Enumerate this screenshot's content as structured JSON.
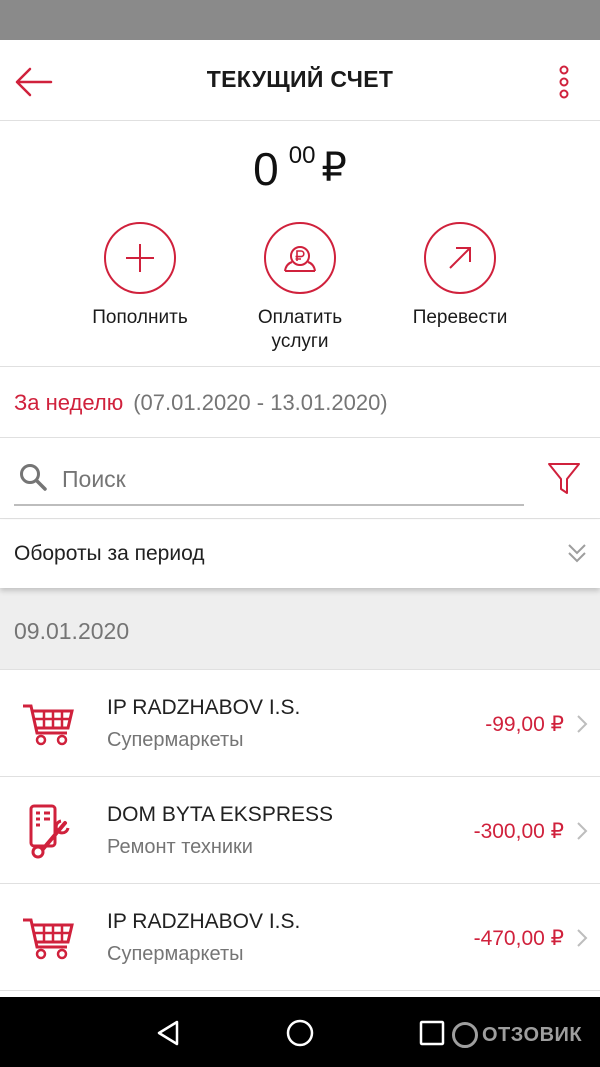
{
  "header": {
    "title": "ТЕКУЩИЙ СЧЕТ",
    "back_icon": "arrow-left-icon",
    "more_icon": "more-vertical-icon"
  },
  "balance": {
    "integer": "0",
    "decimal": "00",
    "currency": "₽"
  },
  "actions": [
    {
      "label": "Пополнить",
      "icon": "plus-icon"
    },
    {
      "label": "Оплатить\nуслуги",
      "icon": "ruble-coin-icon"
    },
    {
      "label": "Перевести",
      "icon": "arrow-up-right-icon"
    }
  ],
  "period": {
    "label": "За неделю",
    "range": "(07.01.2020 - 13.01.2020)"
  },
  "search": {
    "placeholder": "Поиск",
    "value": ""
  },
  "turnover": {
    "label": "Обороты за период"
  },
  "date_group": "09.01.2020",
  "transactions": [
    {
      "name": "IP RADZHABOV I.S.",
      "category": "Супермаркеты",
      "amount": "-99,00 ₽",
      "icon": "cart-icon"
    },
    {
      "name": "DOM BYTA EKSPRESS",
      "category": "Ремонт техники",
      "amount": "-300,00 ₽",
      "icon": "phone-repair-icon"
    },
    {
      "name": "IP RADZHABOV I.S.",
      "category": "Супермаркеты",
      "amount": "-470,00 ₽",
      "icon": "cart-icon"
    }
  ],
  "watermark": "ОТЗОВИК",
  "colors": {
    "accent": "#d0213c",
    "status_bar": "#8a8a8a",
    "nav_bar": "#000000"
  }
}
